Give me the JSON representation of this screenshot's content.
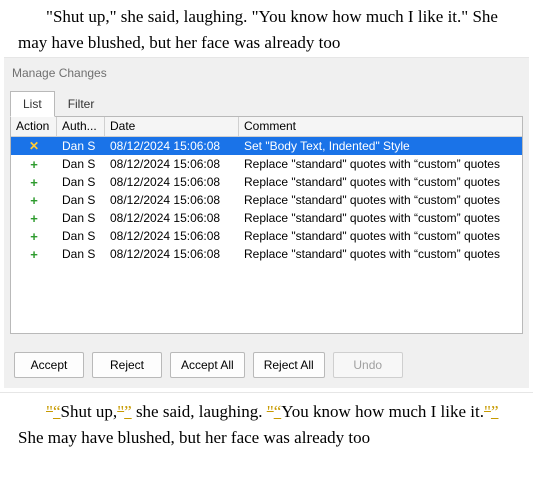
{
  "doc_top": "\"Shut up,\" she said, laughing. \"You know how much I like it.\" She may have blushed, but her face was already too",
  "panel": {
    "title": "Manage Changes",
    "tabs": {
      "list": "List",
      "filter": "Filter"
    },
    "columns": {
      "action": "Action",
      "author": "Auth...",
      "date": "Date",
      "comment": "Comment"
    },
    "rows": [
      {
        "action": "delete",
        "author": "Dan S",
        "date": "08/12/2024 15:06:08",
        "comment": "Set \"Body Text, Indented\" Style",
        "selected": true
      },
      {
        "action": "insert",
        "author": "Dan S",
        "date": "08/12/2024 15:06:08",
        "comment": "Replace \"standard\" quotes with “custom” quotes"
      },
      {
        "action": "insert",
        "author": "Dan S",
        "date": "08/12/2024 15:06:08",
        "comment": "Replace \"standard\" quotes with “custom” quotes"
      },
      {
        "action": "insert",
        "author": "Dan S",
        "date": "08/12/2024 15:06:08",
        "comment": "Replace \"standard\" quotes with “custom” quotes"
      },
      {
        "action": "insert",
        "author": "Dan S",
        "date": "08/12/2024 15:06:08",
        "comment": "Replace \"standard\" quotes with “custom” quotes"
      },
      {
        "action": "insert",
        "author": "Dan S",
        "date": "08/12/2024 15:06:08",
        "comment": "Replace \"standard\" quotes with “custom” quotes"
      },
      {
        "action": "insert",
        "author": "Dan S",
        "date": "08/12/2024 15:06:08",
        "comment": "Replace \"standard\" quotes with “custom” quotes"
      }
    ],
    "buttons": {
      "accept": "Accept",
      "reject": "Reject",
      "accept_all": "Accept All",
      "reject_all": "Reject All",
      "undo": "Undo"
    }
  },
  "doc_bottom_frags": {
    "p1_a": "Shut up,",
    "p1_b": " she said, laughing. ",
    "p1_c": "You know how much I like it.",
    "p1_d": " She may have blushed, but her face was already too",
    "sq_open": "\"",
    "sq_close": "\"",
    "cq_open": "“",
    "cq_close": "”"
  }
}
